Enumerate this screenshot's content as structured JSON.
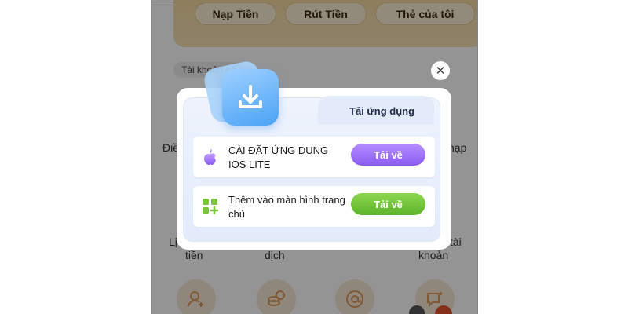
{
  "wallet": {
    "buttons": [
      {
        "label": "Nạp Tiền"
      },
      {
        "label": "Rút Tiền"
      },
      {
        "label": "Thẻ của tôi"
      }
    ]
  },
  "section": {
    "label": "Tài khoản củ"
  },
  "background_labels": {
    "left_row1": "Điề",
    "right_row1": "nạp",
    "left_row2_a": "Lị",
    "left_row2_b": "tiền",
    "mid_row2": "dịch",
    "right_row2_a": "tài",
    "right_row2_b": "khoản"
  },
  "background_icons": [
    "add-user-icon",
    "coins-icon",
    "at-sign-icon",
    "message-star-icon"
  ],
  "modal": {
    "tab_label": "Tải ứng dụng",
    "close_symbol": "✕",
    "options": [
      {
        "text": "CÀI ĐẶT ỨNG DỤNG IOS LITE",
        "button": "Tải về",
        "icon": "apple-icon",
        "button_color": "#9b6cf5"
      },
      {
        "text": "Thêm vào màn hình trang chủ",
        "button": "Tải về",
        "icon": "grid-add-icon",
        "button_color": "#6cc23a"
      }
    ]
  },
  "colors": {
    "overlay": "rgba(0,0,0,0.42)",
    "download_icon": "#4aa3f5",
    "wallet_card": "#f3d79a"
  }
}
